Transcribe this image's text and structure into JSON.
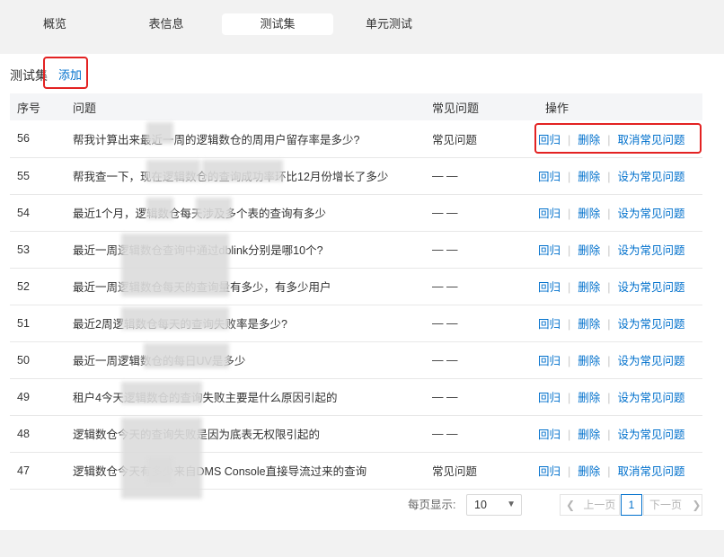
{
  "tabs": [
    {
      "label": "概览"
    },
    {
      "label": "表信息"
    },
    {
      "label": "测试集"
    },
    {
      "label": "单元测试"
    }
  ],
  "section": {
    "title": "测试集",
    "add_label": "添加"
  },
  "table": {
    "headers": [
      "序号",
      "问题",
      "常见问题",
      "操作"
    ],
    "rows": [
      {
        "id": "56",
        "question": "帮我计算出来最近一周的逻辑数仓的周用户留存率是多少?",
        "faq": "常见问题",
        "op1": "回归",
        "op2": "删除",
        "op3": "取消常见问题"
      },
      {
        "id": "55",
        "question": "帮我查一下，现在逻辑数仓的查询成功率环比12月份增长了多少",
        "faq": "— —",
        "op1": "回归",
        "op2": "删除",
        "op3": "设为常见问题"
      },
      {
        "id": "54",
        "question": "最近1个月，逻辑数仓每天涉及多个表的查询有多少",
        "faq": "— —",
        "op1": "回归",
        "op2": "删除",
        "op3": "设为常见问题"
      },
      {
        "id": "53",
        "question": "最近一周逻辑数仓查询中通过dblink分别是哪10个?",
        "faq": "— —",
        "op1": "回归",
        "op2": "删除",
        "op3": "设为常见问题"
      },
      {
        "id": "52",
        "question": "最近一周逻辑数仓每天的查询量有多少，有多少用户",
        "faq": "— —",
        "op1": "回归",
        "op2": "删除",
        "op3": "设为常见问题"
      },
      {
        "id": "51",
        "question": "最近2周逻辑数仓每天的查询失败率是多少?",
        "faq": "— —",
        "op1": "回归",
        "op2": "删除",
        "op3": "设为常见问题"
      },
      {
        "id": "50",
        "question": "最近一周逻辑数仓的每日UV是多少",
        "faq": "— —",
        "op1": "回归",
        "op2": "删除",
        "op3": "设为常见问题"
      },
      {
        "id": "49",
        "question": "租户4今天逻辑数仓的查询失败主要是什么原因引起的",
        "faq": "— —",
        "op1": "回归",
        "op2": "删除",
        "op3": "设为常见问题"
      },
      {
        "id": "48",
        "question": "逻辑数仓今天的查询失败是因为底表无权限引起的",
        "faq": "— —",
        "op1": "回归",
        "op2": "删除",
        "op3": "设为常见问题"
      },
      {
        "id": "47",
        "question": "逻辑数仓今天有多少来自DMS Console直接导流过来的查询",
        "faq": "常见问题",
        "op1": "回归",
        "op2": "删除",
        "op3": "取消常见问题"
      }
    ]
  },
  "pagination": {
    "page_size_label": "每页显示:",
    "page_size": "10",
    "prev_label": "上一页",
    "next_label": "下一页",
    "current_page": "1"
  },
  "colors": {
    "link": "#0070cc",
    "highlight": "#e32222"
  }
}
